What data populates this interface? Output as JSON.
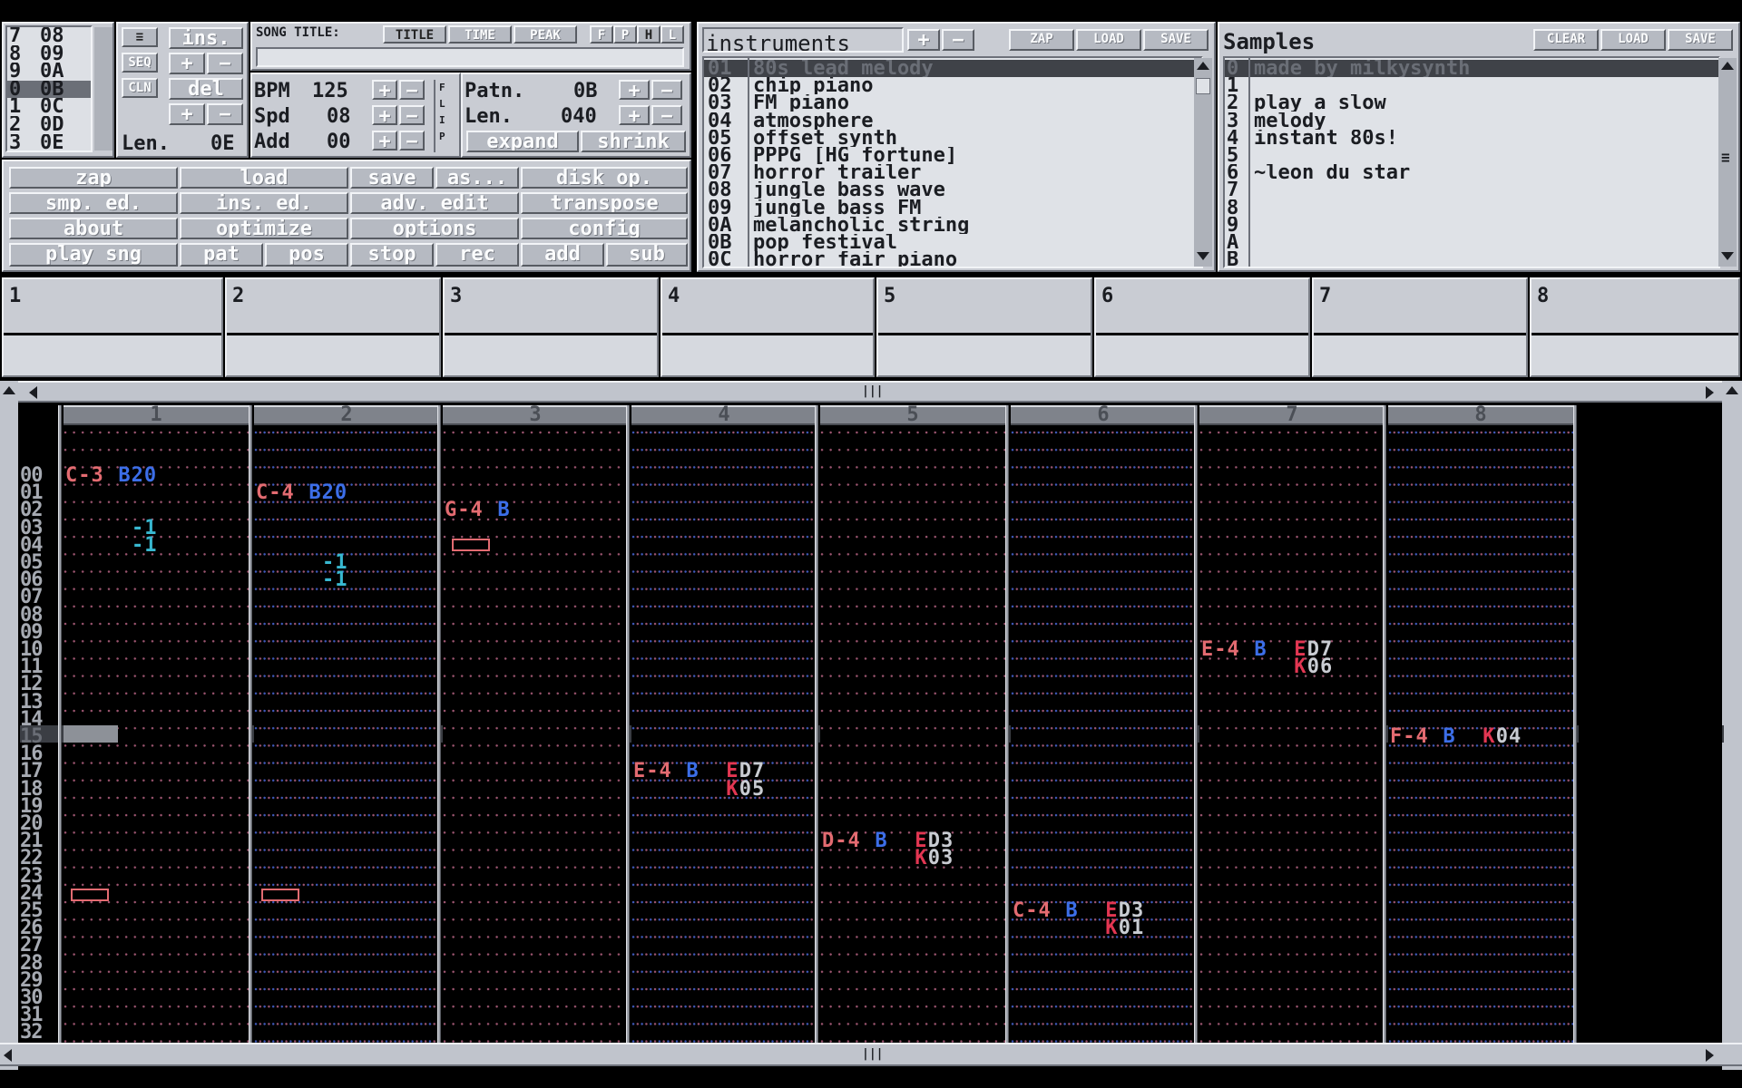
{
  "order": {
    "rows": [
      "7",
      "8",
      "9",
      "0",
      "1",
      "2",
      "3"
    ],
    "vals": [
      "08",
      "09",
      "0A",
      "0B",
      "0C",
      "0D",
      "0E"
    ]
  },
  "seq": {
    "menu": "≡",
    "ins": "ins.",
    "seq": "SEQ",
    "cln": "CLN",
    "del": "del",
    "plus": "+",
    "minus": "−",
    "len_label": "Len.",
    "len_value": "0E",
    "scroll": "≡"
  },
  "song": {
    "title_label": "SONG TITLE:",
    "tabs": [
      "TITLE",
      "TIME",
      "PEAK"
    ],
    "flags": [
      "F",
      "P",
      "H",
      "L"
    ],
    "title_value": ""
  },
  "params": {
    "bpm_label": "BPM",
    "bpm_value": "125",
    "spd_label": "Spd",
    "spd_value": "08",
    "add_label": "Add",
    "add_value": "00",
    "flip": [
      "F",
      "L",
      "I",
      "P"
    ],
    "patn_label": "Patn.",
    "patn_value": "0B",
    "len_label": "Len.",
    "len_value": "040",
    "expand": "expand",
    "shrink": "shrink"
  },
  "main_buttons": [
    [
      "zap",
      "load",
      "save",
      "as...",
      "disk op."
    ],
    [
      "smp. ed.",
      "ins. ed.",
      "adv. edit",
      "transpose"
    ],
    [
      "about",
      "optimize",
      "options",
      "config"
    ],
    [
      "play sng",
      "pat",
      "pos",
      "stop",
      "rec",
      "add",
      "sub"
    ]
  ],
  "instruments": {
    "title": "instruments",
    "zap": "ZAP",
    "load": "LOAD",
    "save": "SAVE",
    "plus": "+",
    "minus": "−",
    "nums": [
      "01",
      "02",
      "03",
      "04",
      "05",
      "06",
      "07",
      "08",
      "09",
      "0A",
      "0B",
      "0C"
    ],
    "names": [
      "80s lead melody",
      "chip piano",
      "FM piano",
      "atmosphere",
      "offset synth",
      "PPPG [HG fortune]",
      "horror trailer",
      "jungle bass wave",
      "jungle bass FM",
      "melancholic string",
      "pop festival",
      "horror fair piano"
    ]
  },
  "samples": {
    "title": "Samples",
    "clear": "CLEAR",
    "load": "LOAD",
    "save": "SAVE",
    "scroll": "≡",
    "nums": [
      "0",
      "1",
      "2",
      "3",
      "4",
      "5",
      "6",
      "7",
      "8",
      "9",
      "A",
      "B"
    ],
    "names": [
      "made by milkysynth",
      "",
      "play a slow",
      "melody",
      "instant 80s!",
      "",
      "~leon du star",
      "",
      "",
      "",
      "",
      ""
    ]
  },
  "channels": [
    "1",
    "2",
    "3",
    "4",
    "5",
    "6",
    "7",
    "8"
  ],
  "pattern": {
    "cols": [
      "1",
      "2",
      "3",
      "4",
      "5",
      "6",
      "7",
      "8"
    ],
    "hscroll": "|||",
    "rows": [
      "00",
      "01",
      "02",
      "03",
      "04",
      "05",
      "06",
      "07",
      "08",
      "09",
      "10",
      "11",
      "12",
      "13",
      "14",
      "15",
      "16",
      "17",
      "18",
      "19",
      "20",
      "21",
      "22",
      "23",
      "24",
      "25",
      "26",
      "27",
      "28",
      "29",
      "30",
      "31",
      "32"
    ],
    "cells": [
      {
        "ch": 0,
        "row": 0,
        "text": "C-3",
        "kind": "n",
        "off": 0
      },
      {
        "ch": 0,
        "row": 0,
        "text": "B20",
        "kind": "i",
        "off": 4
      },
      {
        "ch": 1,
        "row": 1,
        "text": "C-4",
        "kind": "n",
        "off": 0
      },
      {
        "ch": 1,
        "row": 1,
        "text": "B20",
        "kind": "i",
        "off": 4
      },
      {
        "ch": 2,
        "row": 2,
        "text": "G-4",
        "kind": "n",
        "off": 0
      },
      {
        "ch": 2,
        "row": 2,
        "text": "B",
        "kind": "i",
        "off": 4
      },
      {
        "ch": 0,
        "row": 3,
        "text": "-1",
        "kind": "v",
        "off": 5
      },
      {
        "ch": 0,
        "row": 4,
        "text": "-1",
        "kind": "v",
        "off": 5
      },
      {
        "ch": 1,
        "row": 5,
        "text": "-1",
        "kind": "v",
        "off": 5
      },
      {
        "ch": 1,
        "row": 6,
        "text": "-1",
        "kind": "v",
        "off": 5
      },
      {
        "ch": 6,
        "row": 10,
        "text": "E-4",
        "kind": "n",
        "off": 0
      },
      {
        "ch": 6,
        "row": 10,
        "text": "B",
        "kind": "i",
        "off": 4
      },
      {
        "ch": 6,
        "row": 10,
        "text": "E",
        "kind": "e",
        "off": 7
      },
      {
        "ch": 6,
        "row": 10,
        "text": "D7",
        "kind": "p",
        "off": 8
      },
      {
        "ch": 6,
        "row": 11,
        "text": "K",
        "kind": "e",
        "off": 7
      },
      {
        "ch": 6,
        "row": 11,
        "text": "06",
        "kind": "p",
        "off": 8
      },
      {
        "ch": 7,
        "row": 15,
        "text": "F-4",
        "kind": "n",
        "off": 0
      },
      {
        "ch": 7,
        "row": 15,
        "text": "B",
        "kind": "i",
        "off": 4
      },
      {
        "ch": 7,
        "row": 15,
        "text": "K",
        "kind": "e",
        "off": 7
      },
      {
        "ch": 7,
        "row": 15,
        "text": "04",
        "kind": "p",
        "off": 8
      },
      {
        "ch": 3,
        "row": 17,
        "text": "E-4",
        "kind": "n",
        "off": 0
      },
      {
        "ch": 3,
        "row": 17,
        "text": "B",
        "kind": "i",
        "off": 4
      },
      {
        "ch": 3,
        "row": 17,
        "text": "E",
        "kind": "e",
        "off": 7
      },
      {
        "ch": 3,
        "row": 17,
        "text": "D7",
        "kind": "p",
        "off": 8
      },
      {
        "ch": 3,
        "row": 18,
        "text": "K",
        "kind": "e",
        "off": 7
      },
      {
        "ch": 3,
        "row": 18,
        "text": "05",
        "kind": "p",
        "off": 8
      },
      {
        "ch": 4,
        "row": 21,
        "text": "D-4",
        "kind": "n",
        "off": 0
      },
      {
        "ch": 4,
        "row": 21,
        "text": "B",
        "kind": "i",
        "off": 4
      },
      {
        "ch": 4,
        "row": 21,
        "text": "E",
        "kind": "e",
        "off": 7
      },
      {
        "ch": 4,
        "row": 21,
        "text": "D3",
        "kind": "p",
        "off": 8
      },
      {
        "ch": 4,
        "row": 22,
        "text": "K",
        "kind": "e",
        "off": 7
      },
      {
        "ch": 4,
        "row": 22,
        "text": "03",
        "kind": "p",
        "off": 8
      },
      {
        "ch": 5,
        "row": 25,
        "text": "C-4",
        "kind": "n",
        "off": 0
      },
      {
        "ch": 5,
        "row": 25,
        "text": "B",
        "kind": "i",
        "off": 4
      },
      {
        "ch": 5,
        "row": 25,
        "text": "E",
        "kind": "e",
        "off": 7
      },
      {
        "ch": 5,
        "row": 25,
        "text": "D3",
        "kind": "p",
        "off": 8
      },
      {
        "ch": 5,
        "row": 26,
        "text": "K",
        "kind": "e",
        "off": 7
      },
      {
        "ch": 5,
        "row": 26,
        "text": "01",
        "kind": "p",
        "off": 8
      }
    ]
  },
  "colors": {
    "note": "#e36b71",
    "instrument": "#3c6ee8",
    "volume": "#38b8d0",
    "effect": "#e33652",
    "panel": "#c3c7cf"
  }
}
